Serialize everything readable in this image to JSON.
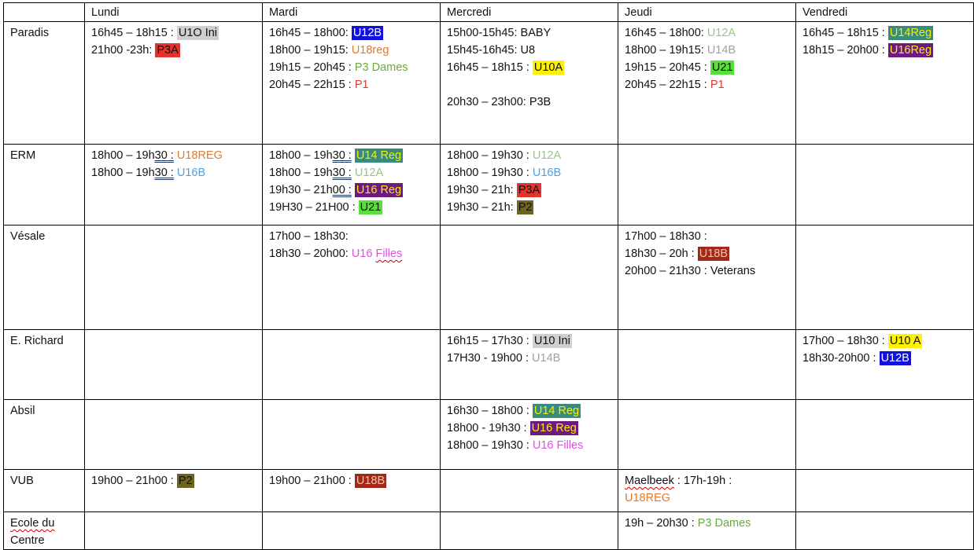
{
  "days": [
    "Lundi",
    "Mardi",
    "Mercredi",
    "Jeudi",
    "Vendredi"
  ],
  "colors": {
    "grey_hl": "#cfcfcf",
    "red_hl": "#e3332a",
    "blue_hl": "#1010e0",
    "yellow_hl": "#fff200",
    "teal_hl": "#3a8a7e",
    "purple_hl": "#6e1a82",
    "green_hl": "#57e03c",
    "olive_hl": "#6d6420",
    "brown_hl": "#a3281a",
    "orange_text": "#e07a2e",
    "green_text": "#6aaa3a",
    "red_text": "#e03a2a",
    "sage_text": "#9cc28a",
    "grey_text": "#a0a0a0",
    "skyblue_text": "#4ea0e0",
    "pink_text": "#e050e0"
  },
  "rows": [
    {
      "venue": "Paradis",
      "cells": [
        [
          {
            "t": "16h45 – 18h15 : ",
            "tag": "U1O Ini",
            "style": "grey-hl"
          },
          {
            "t": "21h00 -23h: ",
            "tag": "P3A",
            "style": "red-hl"
          }
        ],
        [
          {
            "t": "16h45 – 18h00: ",
            "tag": "U12B",
            "style": "blue-hl"
          },
          {
            "t": "18h00 – 19h15: ",
            "tag": "U18reg",
            "style": "orange-text"
          },
          {
            "t": "19h15 – 20h45 : ",
            "tag": "P3 Dames",
            "style": "green-text"
          },
          {
            "t": "20h45 – 22h15 : ",
            "tag": "P1",
            "style": "red-text"
          }
        ],
        [
          {
            "t": "15h00-15h45: BABY"
          },
          {
            "t": "15h45-16h45: U8"
          },
          {
            "t": "16h45 – 18h15 : ",
            "tag": "U10A",
            "style": "yellow-hl"
          },
          {
            "gap": true
          },
          {
            "t": "20h30 – 23h00: P3B"
          }
        ],
        [
          {
            "t": "16h45 – 18h00: ",
            "tag": "U12A",
            "style": "sage-text"
          },
          {
            "t": "18h00 – 19h15: ",
            "tag": "U14B",
            "style": "grey-text"
          },
          {
            "t": "19h15 – 20h45 : ",
            "tag": "U21",
            "style": "green-hl"
          },
          {
            "t": "20h45 – 22h15 : ",
            "tag": "P1",
            "style": "red-text"
          }
        ],
        [
          {
            "t": "16h45 – 18h15 : ",
            "tag": "U14Reg",
            "style": "teal-hl-y"
          },
          {
            "t": "18h15 – 20h00 : ",
            "tag": "U16Reg",
            "style": "purple-hl-y"
          }
        ]
      ]
    },
    {
      "venue": "ERM",
      "cells": [
        [
          {
            "t": "18h00 – 19h",
            "u": "30 :",
            "t2": " ",
            "tag": "U18REG",
            "style": "orange-text"
          },
          {
            "t": "18h00 – 19h",
            "u": "30 :",
            "t2": " ",
            "tag": "U16B",
            "style": "skyblue-text"
          }
        ],
        [
          {
            "t": "18h00 – 19h",
            "u": "30 :",
            "t2": " ",
            "tag": "U14 Reg",
            "style": "teal-hl-y"
          },
          {
            "t": "18h00 – 19h",
            "u": "30 :",
            "t2": " ",
            "tag": "U12A",
            "style": "sage-text"
          },
          {
            "t": "19h30 – 21h",
            "u": "00 :",
            "t2": " ",
            "tag": "U16 Reg",
            "style": "purple-hl-y"
          },
          {
            "t": "19H30 – 21H00 : ",
            "tag": "U21",
            "style": "green-hl"
          }
        ],
        [
          {
            "t": "18h00 – 19h30 : ",
            "tag": "U12A",
            "style": "sage-text"
          },
          {
            "t": "18h00 – 19h30 : ",
            "tag": "U16B",
            "style": "skyblue-text"
          },
          {
            "t": "19h30 – 21h: ",
            "tag": "P3A",
            "style": "red-hl"
          },
          {
            "t": "19h30 – 21h: ",
            "tag": "P2",
            "style": "olive-hl"
          }
        ],
        [],
        []
      ]
    },
    {
      "venue": "Vésale",
      "cells": [
        [],
        [
          {
            "t": "17h00 – 18h30:"
          },
          {
            "t": "18h30 – 20h00: ",
            "tag": "U16 ",
            "tag2": "Filles",
            "style": "pink-text"
          }
        ],
        [],
        [
          {
            "t": "17h00 – 18h30 :"
          },
          {
            "t": "18h30 – 20h : ",
            "tag": "U18B",
            "style": "brown-hl"
          },
          {
            "t": "20h00 – 21h30 : Veterans"
          }
        ],
        []
      ]
    },
    {
      "venue": "E. Richard",
      "cells": [
        [],
        [],
        [
          {
            "t": "16h15 – 17h30 : ",
            "tag": "U10 Ini",
            "style": "grey-hl"
          },
          {
            "t": "17H30 - 19h00 : ",
            "tag": "U14B",
            "style": "grey-text"
          }
        ],
        [],
        [
          {
            "t": "17h00 – 18h30 : ",
            "tag": "U10 A",
            "style": "yellow-hl"
          },
          {
            "t": "18h30-20h00 : ",
            "tag": "U12B",
            "style": "blue-hl"
          }
        ]
      ]
    },
    {
      "venue": "Absil",
      "cells": [
        [],
        [],
        [
          {
            "t": "16h30 – 18h00 : ",
            "tag": "U14 Reg",
            "style": "teal-hl-y"
          },
          {
            "t": "18h00 - 19h30 : ",
            "tag": "U16 Reg",
            "style": "purple-hl-y"
          },
          {
            "t": "18h00 – 19h30 : ",
            "tag": "U16 Filles",
            "style": "pink-text"
          }
        ],
        [],
        []
      ]
    },
    {
      "venue": "VUB",
      "cells": [
        [
          {
            "t": "19h00 – 21h00 : ",
            "tag": "P2",
            "style": "olive-hl"
          }
        ],
        [
          {
            "t": "19h00 – 21h00 : ",
            "tag": "U18B",
            "style": "brown-hl"
          }
        ],
        [],
        [
          {
            "w": "Maelbeek",
            "t": " : 17h-19h :"
          },
          {
            "t": "",
            "tag": "U18REG",
            "style": "orange-text"
          }
        ],
        []
      ]
    },
    {
      "venue": "Ecole du",
      "venue2": "Centre",
      "cells": [
        [],
        [],
        [],
        [
          {
            "t": "19h – 20h30 : ",
            "tag": "P3 Dames",
            "style": "green-text"
          }
        ],
        []
      ]
    }
  ]
}
